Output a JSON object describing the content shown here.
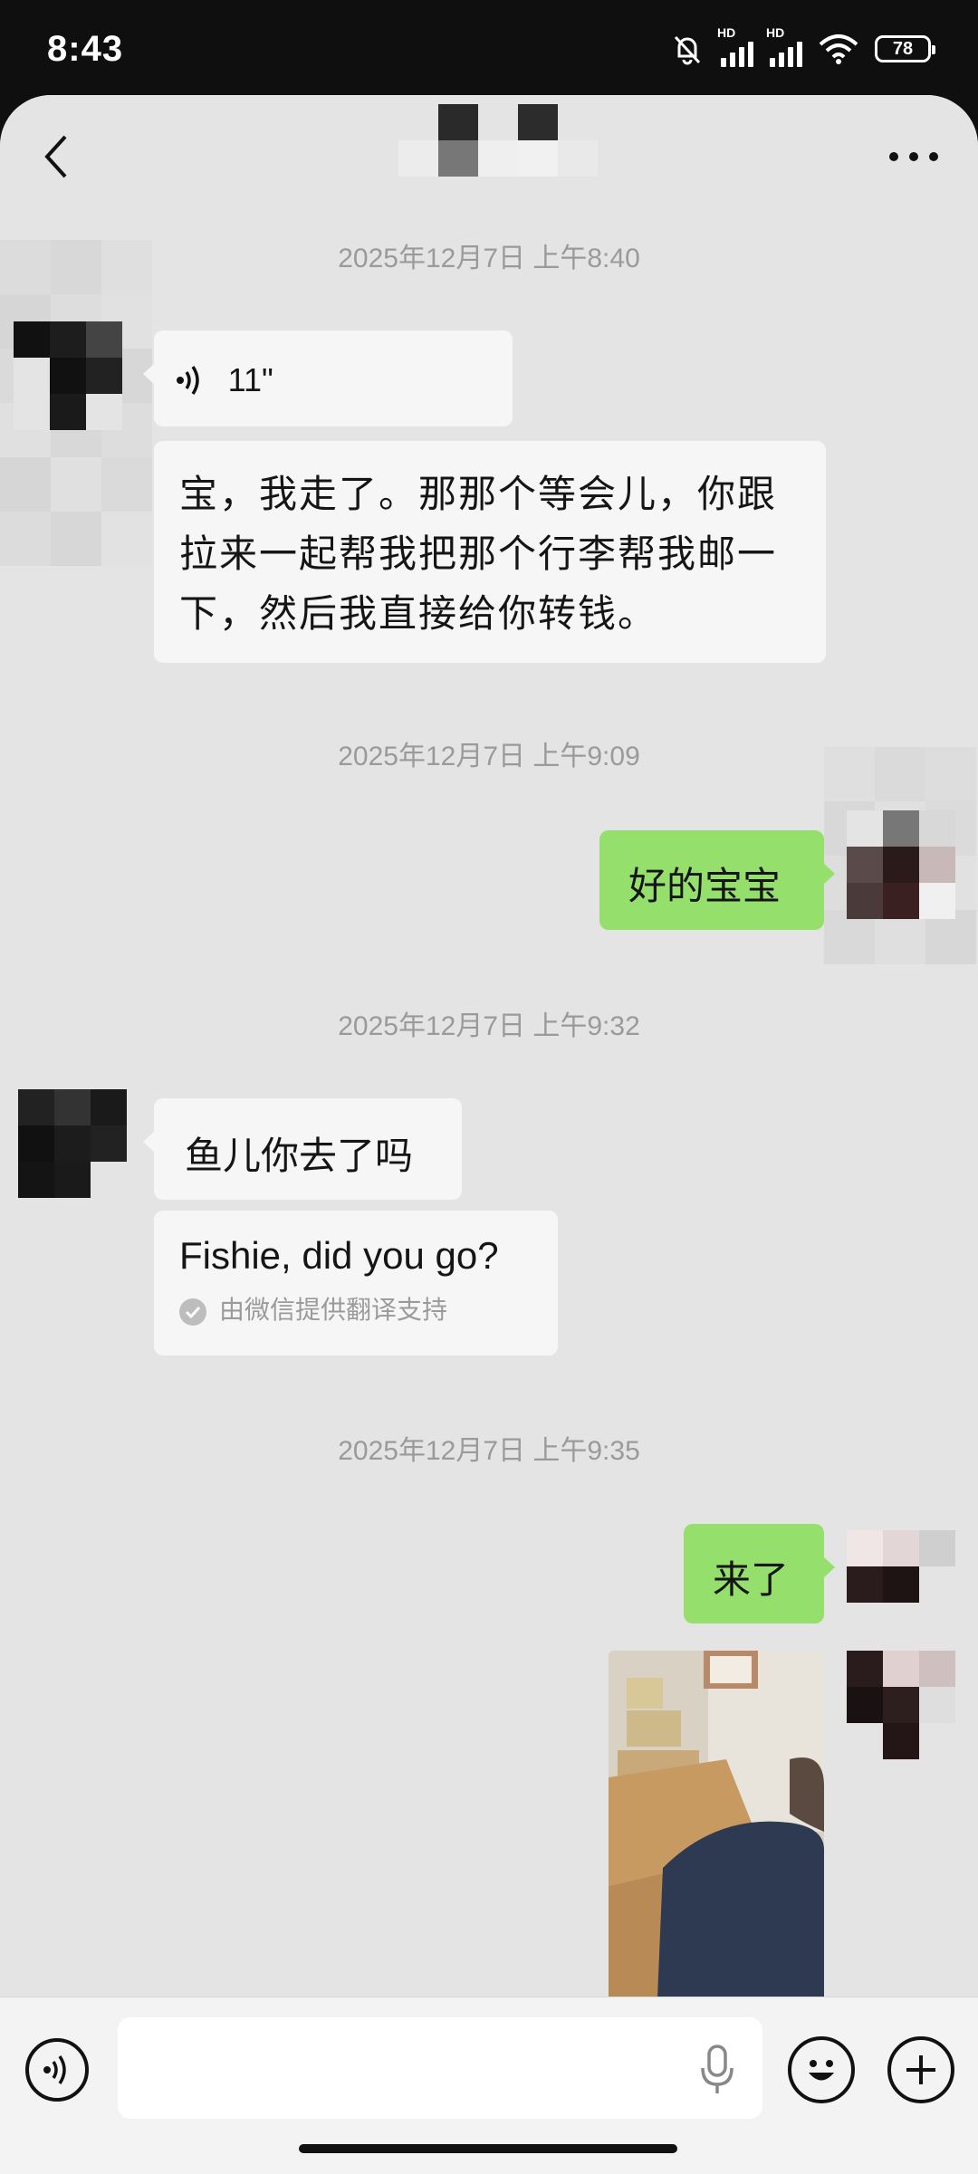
{
  "status_bar": {
    "time": "8:43",
    "signal_labels": [
      "HD",
      "HD"
    ],
    "battery": "78",
    "icons": [
      "bell-muted-icon",
      "signal-icon",
      "signal-icon",
      "wifi-icon",
      "battery-icon"
    ]
  },
  "nav": {
    "back_icon": "chevron-left-icon",
    "more_icon": "more-dots-icon"
  },
  "messages": {
    "ts1": "2025年12月7日 上午8:40",
    "voice_duration": "11\"",
    "text1": "宝，我走了。那那个等会儿，你跟拉来一起帮我把那个行李帮我邮一下，然后我直接给你转钱。",
    "ts2": "2025年12月7日 上午9:09",
    "reply1": "好的宝宝",
    "ts3": "2025年12月7日 上午9:32",
    "text2": "鱼儿你去了吗",
    "translation": "Fishie, did you go?",
    "translation_source": "由微信提供翻译支持",
    "ts4": "2025年12月7日 上午9:35",
    "reply2": "来了"
  },
  "input_bar": {
    "placeholder": "",
    "icons": [
      "voice-mode-icon",
      "microphone-icon",
      "emoji-icon",
      "plus-icon"
    ]
  },
  "colors": {
    "chat_background": "#e4e4e4",
    "incoming_bubble": "#f6f6f6",
    "outgoing_bubble": "#95e06c",
    "timestamp": "#9a9a9a"
  }
}
